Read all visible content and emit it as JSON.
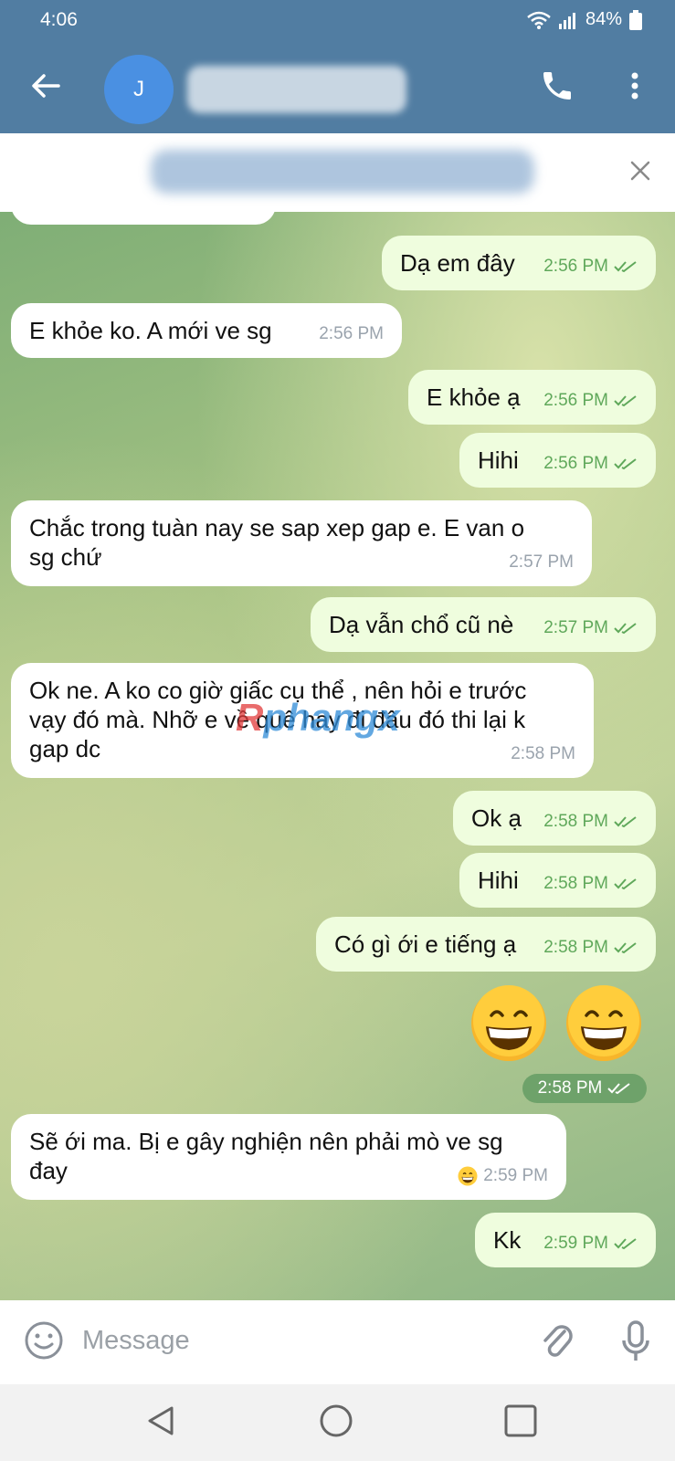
{
  "status_bar": {
    "time": "4:06",
    "battery": "84%"
  },
  "header": {
    "avatar_letter": "J"
  },
  "watermark": {
    "prefix": "R",
    "text": "phangx"
  },
  "messages": [
    {
      "dir": "in",
      "text": "E khỏe ko. A mới ve sg",
      "time": "2:56 PM"
    },
    {
      "dir": "out",
      "text": "Dạ em đây",
      "time": "2:56 PM"
    },
    {
      "dir": "out",
      "text": "E khỏe ạ",
      "time": "2:56 PM"
    },
    {
      "dir": "out",
      "text": "Hihi",
      "time": "2:56 PM"
    },
    {
      "dir": "in",
      "text": "Chắc trong tuàn nay se sap xep gap e. E van o sg chứ",
      "time": "2:57 PM"
    },
    {
      "dir": "out",
      "text": "Dạ vẫn chổ cũ nè",
      "time": "2:57 PM"
    },
    {
      "dir": "in",
      "text": "Ok ne. A ko co giờ giấc cụ thể , nên hỏi e trước vạy đó mà. Nhỡ e về quê hay đi đâu đó thi lại k gap dc",
      "time": "2:58 PM"
    },
    {
      "dir": "out",
      "text": "Ok ạ",
      "time": "2:58 PM"
    },
    {
      "dir": "out",
      "text": "Hihi",
      "time": "2:58 PM"
    },
    {
      "dir": "out",
      "text": "Có gì ới e tiếng ạ",
      "time": "2:58 PM"
    },
    {
      "dir": "out",
      "text": "😁😁",
      "time": "2:58 PM"
    },
    {
      "dir": "in",
      "text": "Sẽ ới ma. Bị e gây nghiện nên phải mò ve sg đay",
      "time": "2:59 PM"
    },
    {
      "dir": "out",
      "text": "Kk",
      "time": "2:59 PM"
    }
  ],
  "input": {
    "placeholder": "Message"
  },
  "icons": [
    "back-arrow-icon",
    "phone-icon",
    "more-vert-icon",
    "close-icon",
    "smile-icon",
    "paperclip-icon",
    "mic-icon",
    "double-check-icon",
    "nav-back-icon",
    "nav-home-icon",
    "nav-recents-icon"
  ],
  "colors": {
    "header": "#517da2",
    "out_bubble": "#effdde",
    "in_bubble": "#ffffff",
    "check": "#5fa85a"
  }
}
